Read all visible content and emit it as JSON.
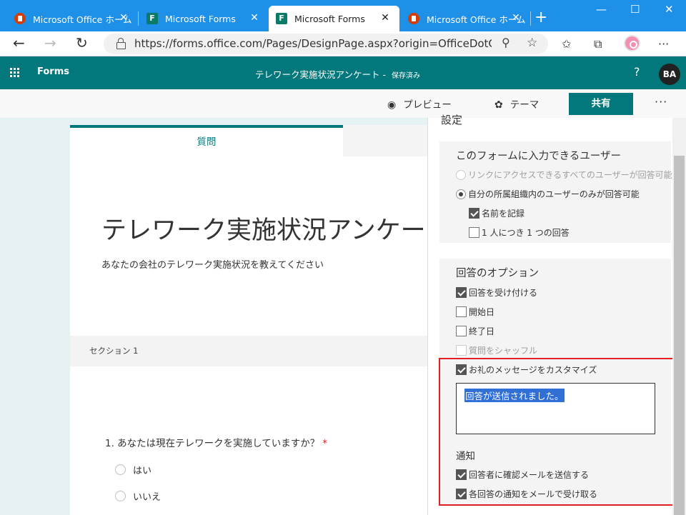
{
  "browser": {
    "tabs": [
      {
        "label": "Microsoft Office ホーム",
        "favicon": "office-icon",
        "active": false
      },
      {
        "label": "Microsoft Forms",
        "favicon": "forms-icon",
        "active": false
      },
      {
        "label": "Microsoft Forms",
        "favicon": "forms-icon",
        "active": true
      },
      {
        "label": "Microsoft Office ホーム",
        "favicon": "office-icon",
        "active": false
      }
    ],
    "tab_close": "✕",
    "new_tab": "+",
    "window": {
      "minimize": "—",
      "maximize": "☐",
      "close": "✕"
    },
    "url": "https://forms.office.com/Pages/DesignPage.aspx?origin=OfficeDotC...",
    "nav": {
      "back": "←",
      "forward": "→",
      "refresh": "↻"
    },
    "toolbar_icons": {
      "zoom": "⚲",
      "favorite": "☆",
      "favorites": "✩",
      "collections": "⧉",
      "more": "···"
    }
  },
  "app": {
    "brand": "Forms",
    "title": "テレワーク実施状況アンケート",
    "saved_sep": " - ",
    "saved": "保存済み",
    "help": "?",
    "user_initials": "BA",
    "accent": "#03787c"
  },
  "toolbar": {
    "preview_label": "プレビュー",
    "preview_icon": "◉",
    "theme_label": "テーマ",
    "theme_icon": "✿",
    "share_label": "共有",
    "more": "···"
  },
  "form": {
    "tab_questions": "質問",
    "title": "テレワーク実施状況アンケート",
    "description": "あなたの会社のテレワーク実施状況を教えてください",
    "section_label": "セクション 1",
    "question1": "1. あなたは現在テレワークを実施していますか？",
    "required_mark": "*",
    "options": [
      "はい",
      "いいえ"
    ]
  },
  "settings": {
    "header": "設定",
    "who": {
      "title": "このフォームに入力できるユーザー",
      "opt_anyone": "リンクにアクセスできるすべてのユーザーが回答可能",
      "opt_org": "自分の所属組織内のユーザーのみが回答可能",
      "record_name": "名前を記録",
      "one_response": "1 人につき 1 つの回答"
    },
    "options": {
      "title": "回答のオプション",
      "accept": "回答を受け付ける",
      "start": "開始日",
      "end": "終了日",
      "shuffle": "質問をシャッフル",
      "custom_msg": "お礼のメッセージをカスタマイズ",
      "message_value": "回答が送信されました。"
    },
    "notify": {
      "title": "通知",
      "receipt": "回答者に確認メールを送信する",
      "each": "各回答の通知をメールで受け取る"
    }
  }
}
